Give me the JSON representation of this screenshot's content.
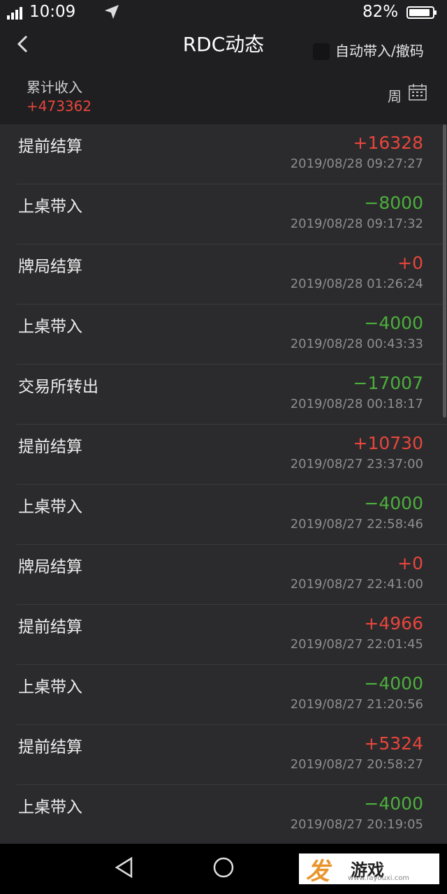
{
  "status_bar": {
    "time": "10:09",
    "battery": "82%"
  },
  "header": {
    "title": "RDC动态",
    "auto_label": "自动带入/撤码"
  },
  "summary": {
    "label": "累计收入",
    "value": "+473362",
    "period": "周"
  },
  "records": [
    {
      "label": "提前结算",
      "amount": "+16328",
      "time": "2019/08/28 09:27:27",
      "sign": "pos"
    },
    {
      "label": "上桌带入",
      "amount": "−8000",
      "time": "2019/08/28 09:17:32",
      "sign": "neg"
    },
    {
      "label": "牌局结算",
      "amount": "+0",
      "time": "2019/08/28 01:26:24",
      "sign": "pos"
    },
    {
      "label": "上桌带入",
      "amount": "−4000",
      "time": "2019/08/28 00:43:33",
      "sign": "neg"
    },
    {
      "label": "交易所转出",
      "amount": "−17007",
      "time": "2019/08/28 00:18:17",
      "sign": "neg"
    },
    {
      "label": "提前结算",
      "amount": "+10730",
      "time": "2019/08/27 23:37:00",
      "sign": "pos"
    },
    {
      "label": "上桌带入",
      "amount": "−4000",
      "time": "2019/08/27 22:58:46",
      "sign": "neg"
    },
    {
      "label": "牌局结算",
      "amount": "+0",
      "time": "2019/08/27 22:41:00",
      "sign": "pos"
    },
    {
      "label": "提前结算",
      "amount": "+4966",
      "time": "2019/08/27 22:01:45",
      "sign": "pos"
    },
    {
      "label": "上桌带入",
      "amount": "−4000",
      "time": "2019/08/27 21:20:56",
      "sign": "neg"
    },
    {
      "label": "提前结算",
      "amount": "+5324",
      "time": "2019/08/27 20:58:27",
      "sign": "pos"
    },
    {
      "label": "上桌带入",
      "amount": "−4000",
      "time": "2019/08/27 20:19:05",
      "sign": "neg"
    }
  ],
  "watermark": {
    "brand": "发",
    "name": "游戏",
    "url": "www.fayouxi.com"
  },
  "colors": {
    "positive": "#e8453c",
    "negative": "#4caf3c",
    "background": "#2b2b2d"
  }
}
